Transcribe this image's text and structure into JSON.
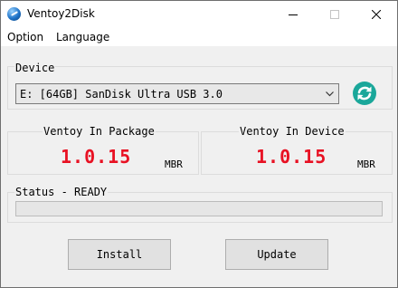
{
  "window": {
    "title": "Ventoy2Disk"
  },
  "menu": {
    "items": [
      {
        "label": "Option"
      },
      {
        "label": "Language"
      }
    ]
  },
  "device": {
    "group_label": "Device",
    "selected_value": "E: [64GB] SanDisk Ultra USB 3.0",
    "refresh_icon": "refresh-icon",
    "refresh_color": "#1aa79a"
  },
  "versions": {
    "package": {
      "label": "Ventoy In Package",
      "value": "1.0.15",
      "style": "MBR"
    },
    "device": {
      "label": "Ventoy In Device",
      "value": "1.0.15",
      "style": "MBR"
    },
    "value_color": "#e81123"
  },
  "status": {
    "label": "Status - READY",
    "progress": 0
  },
  "buttons": {
    "install_label": "Install",
    "update_label": "Update"
  }
}
